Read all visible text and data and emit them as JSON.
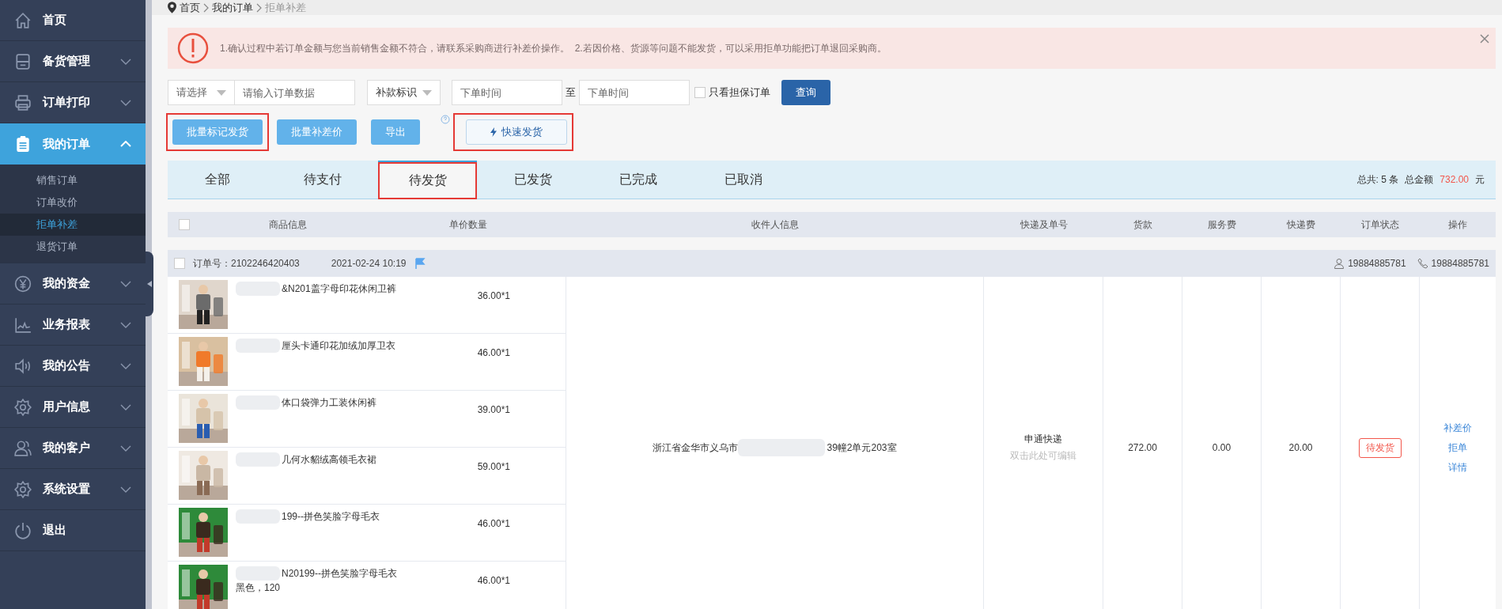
{
  "sidebar": {
    "items": [
      {
        "label": "首页",
        "kind": "link",
        "expanded": false
      },
      {
        "label": "备货管理",
        "kind": "group",
        "expanded": false
      },
      {
        "label": "订单打印",
        "kind": "group",
        "expanded": false
      },
      {
        "label": "我的订单",
        "kind": "group",
        "expanded": true,
        "children": [
          {
            "label": "销售订单",
            "selected": false
          },
          {
            "label": "订单改价",
            "selected": false
          },
          {
            "label": "拒单补差",
            "selected": true
          },
          {
            "label": "退货订单",
            "selected": false
          }
        ]
      },
      {
        "label": "我的资金",
        "kind": "group",
        "expanded": false
      },
      {
        "label": "业务报表",
        "kind": "group",
        "expanded": false
      },
      {
        "label": "我的公告",
        "kind": "group",
        "expanded": false
      },
      {
        "label": "用户信息",
        "kind": "group",
        "expanded": false
      },
      {
        "label": "我的客户",
        "kind": "group",
        "expanded": false
      },
      {
        "label": "系统设置",
        "kind": "group",
        "expanded": false
      },
      {
        "label": "退出",
        "kind": "link",
        "expanded": false
      }
    ]
  },
  "breadcrumb": [
    "首页",
    "我的订单",
    "拒单补差"
  ],
  "alert": {
    "text": "1.确认过程中若订单金额与您当前销售金额不符合，请联系采购商进行补差价操作。  2.若因价格、货源等问题不能发货，可以采用拒单功能把订单退回采购商。"
  },
  "filters": {
    "select": {
      "placeholder": "请选择"
    },
    "keyword": {
      "placeholder": "请输入订单数据"
    },
    "tag_select": {
      "value": "补款标识"
    },
    "date_from": {
      "placeholder": "下单时间"
    },
    "date_sep": "至",
    "date_to": {
      "placeholder": "下单时间"
    },
    "guarantee_only": {
      "label": "只看担保订单",
      "checked": false
    },
    "search_button": "查询"
  },
  "actions": [
    {
      "label": "批量标记发货",
      "kind": "primary",
      "highlighted": true
    },
    {
      "label": "批量补差价",
      "kind": "primary",
      "highlighted": false
    },
    {
      "label": "导出",
      "kind": "primary",
      "highlighted": false
    },
    {
      "label": "快速发货",
      "kind": "outline",
      "highlighted": true
    }
  ],
  "tabs": [
    {
      "label": "全部",
      "selected": false,
      "highlighted": false
    },
    {
      "label": "待支付",
      "selected": false,
      "highlighted": false
    },
    {
      "label": "待发货",
      "selected": true,
      "highlighted": true
    },
    {
      "label": "已发货",
      "selected": false,
      "highlighted": false
    },
    {
      "label": "已完成",
      "selected": false,
      "highlighted": false
    },
    {
      "label": "已取消",
      "selected": false,
      "highlighted": false
    }
  ],
  "summary": {
    "count_label": "总共: 5 条",
    "amount_label": "总金额",
    "amount": "732.00",
    "unit": "元"
  },
  "table": {
    "columns": [
      "商品信息",
      "单价数量",
      "收件人信息",
      "快递及单号",
      "货款",
      "服务费",
      "快递费",
      "订单状态",
      "操作"
    ],
    "select_all": false,
    "orders": [
      {
        "checked": false,
        "order_no": "订单号：2102246420403",
        "time": "2021-02-24 10:19",
        "flagged": true,
        "buyer": "19884885781",
        "phone": "19884885781",
        "items": [
          {
            "name": "&N201盖字母印花休闲卫裤",
            "price": "36.00*1"
          },
          {
            "name": "厘头卡通印花加绒加厚卫衣",
            "price": "46.00*1"
          },
          {
            "name": "体口袋弹力工装休闲裤",
            "price": "39.00*1"
          },
          {
            "name": "几何水貂绒高领毛衣裙",
            "price": "59.00*1"
          },
          {
            "name": "199--拼色笑脸字母毛衣",
            "price": "46.00*1"
          },
          {
            "name": "N20199--拼色笑脸字母毛衣",
            "spec": "黑色，120",
            "price": "46.00*1"
          }
        ],
        "address_start": "浙江省金华市义乌市",
        "address_end": "39幢2单元203室",
        "courier": "申通快递",
        "courier_hint": "双击此处可编辑",
        "goods": "272.00",
        "service": "0.00",
        "shipping": "20.00",
        "status": "待发货",
        "ops": [
          "补差价",
          "拒单",
          "详情"
        ]
      }
    ]
  }
}
